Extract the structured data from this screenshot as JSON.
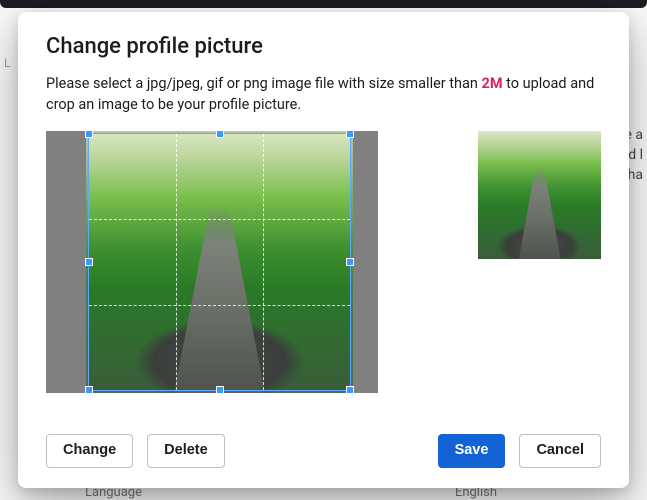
{
  "modal": {
    "title": "Change profile picture",
    "instruction_pre": "Please select a jpg/jpeg, gif or png image file with size smaller than ",
    "size_limit": "2M",
    "instruction_post": " to upload and crop an image to be your profile picture."
  },
  "buttons": {
    "change": "Change",
    "delete": "Delete",
    "save": "Save",
    "cancel": "Cancel"
  },
  "background": {
    "left_fragment": "L",
    "right_fragment_1": "e a",
    "right_fragment_2": "d l",
    "right_fragment_3": "ha",
    "bottom_left": "Language",
    "bottom_right": "English"
  }
}
